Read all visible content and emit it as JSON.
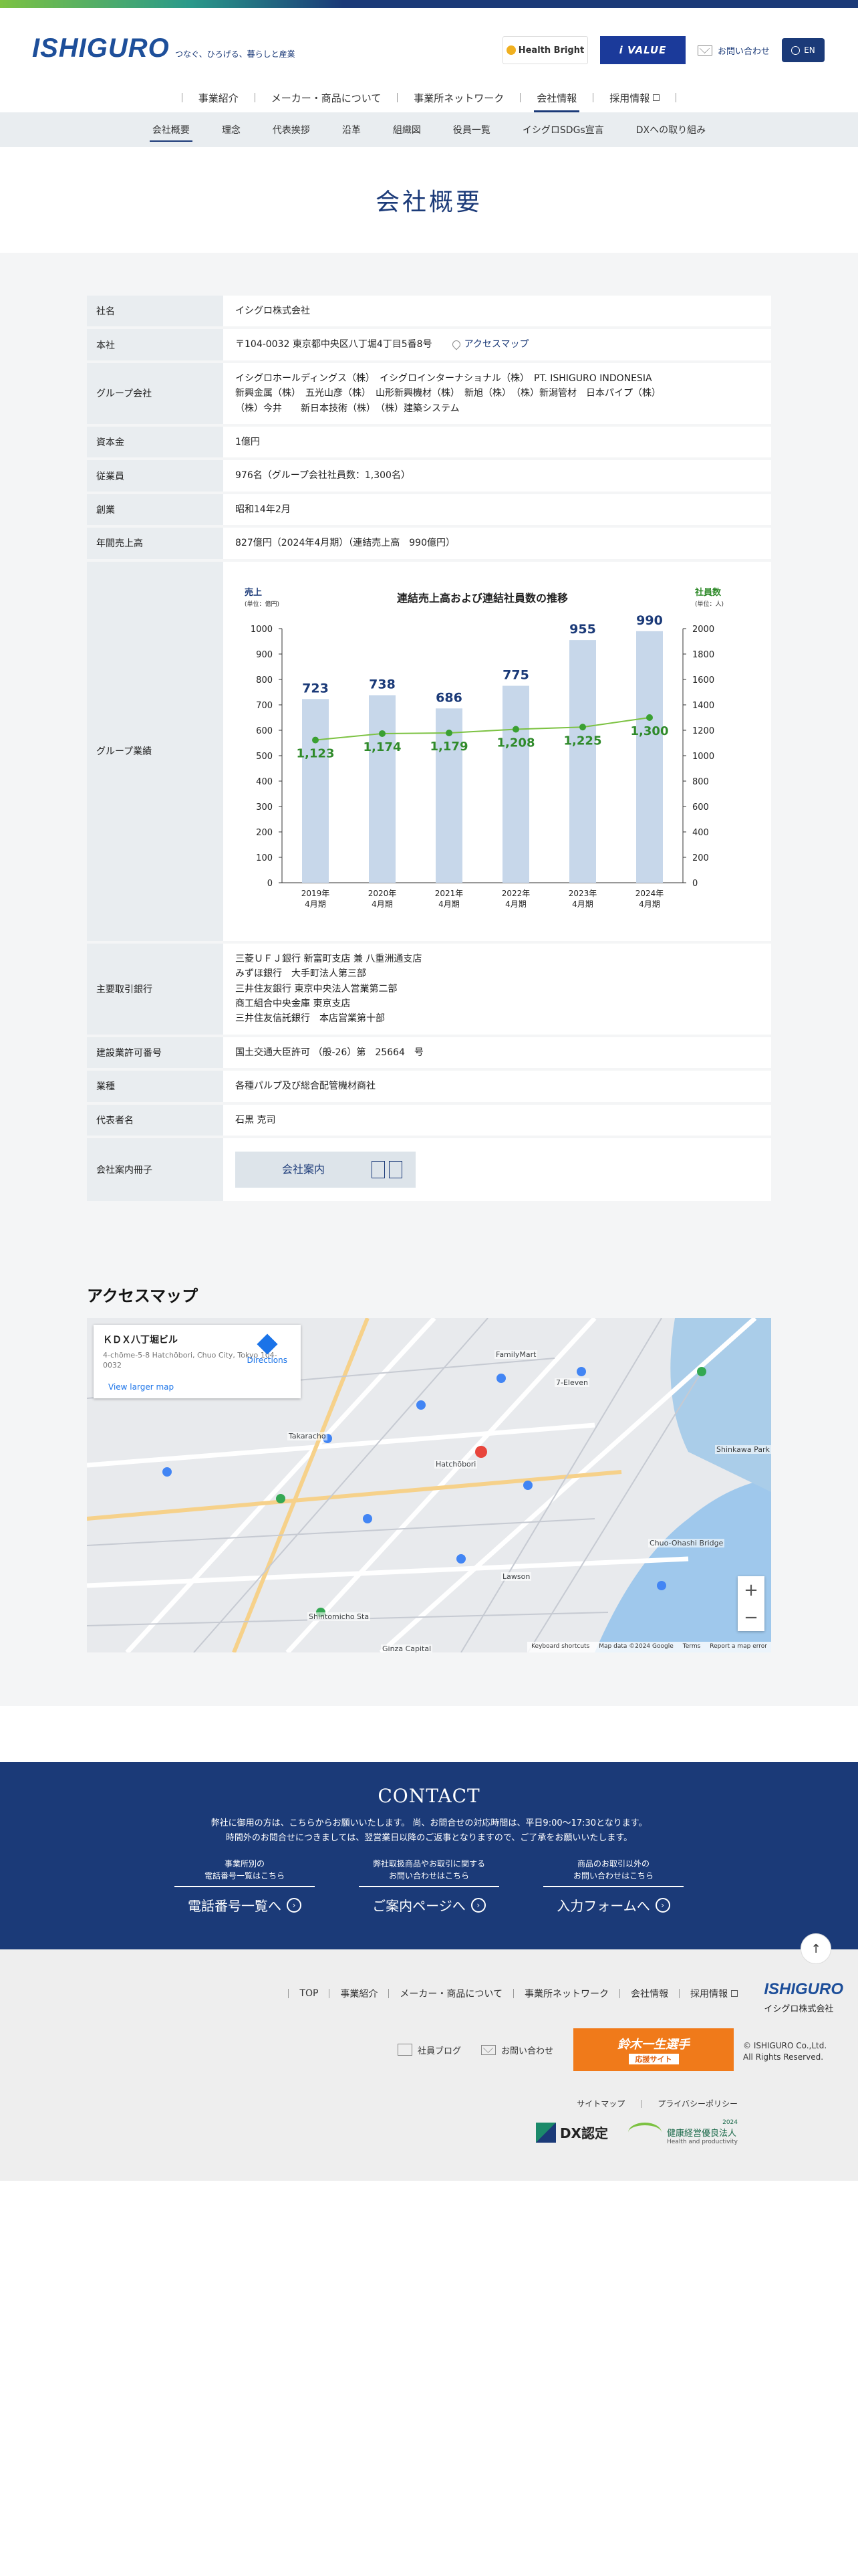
{
  "header": {
    "logo": "ISHIGURO",
    "tagline": "つなぐ、ひろげる、暮らしと産業",
    "badge_health": "Health Bright",
    "badge_ivalue": "i VALUE",
    "contact": "お問い合わせ",
    "lang": "EN"
  },
  "main_nav": [
    {
      "label": "事業紹介",
      "ext": false
    },
    {
      "label": "メーカー・商品について",
      "ext": false
    },
    {
      "label": "事業所ネットワーク",
      "ext": false
    },
    {
      "label": "会社情報",
      "ext": false
    },
    {
      "label": "採用情報",
      "ext": true
    }
  ],
  "sub_nav": [
    "会社概要",
    "理念",
    "代表挨拶",
    "沿革",
    "組織図",
    "役員一覧",
    "イシグロSDGs宣言",
    "DXへの取り組み"
  ],
  "page_title": "会社概要",
  "info": {
    "rows": [
      {
        "label": "社名",
        "value": "イシグロ株式会社"
      },
      {
        "label": "本社",
        "value": "〒104-0032 東京都中央区八丁堀4丁目5番8号",
        "link": "アクセスマップ"
      },
      {
        "label": "グループ会社",
        "value": "イシグロホールディングス（株）　イシグロインターナショナル（株）　PT. ISHIGURO INDONESIA\n新興金属（株）　五光山彦（株）　山形新興機材（株）　新旭（株）　（株）新潟管材　日本パイプ（株）\n（株）今井　　新日本技術（株）　（株）建築システム"
      },
      {
        "label": "資本金",
        "value": "1億円"
      },
      {
        "label": "従業員",
        "value": "976名（グループ会社社員数：1,300名）"
      },
      {
        "label": "創業",
        "value": "昭和14年2月"
      },
      {
        "label": "年間売上高",
        "value": "827億円（2024年4月期）（連結売上高　990億円）"
      }
    ],
    "chart_label": "グループ業績",
    "rows2": [
      {
        "label": "主要取引銀行",
        "value": "三菱ＵＦＪ銀行 新富町支店 兼 八重洲通支店\nみずほ銀行　大手町法人第三部\n三井住友銀行 東京中央法人営業第二部\n商工組合中央金庫 東京支店\n三井住友信託銀行　本店営業第十部"
      },
      {
        "label": "建設業許可番号",
        "value": "国土交通大臣許可 （般-26）第　25664　号"
      },
      {
        "label": "業種",
        "value": "各種パルプ及び総合配管機材商社"
      },
      {
        "label": "代表者名",
        "value": "石黒 克司"
      }
    ],
    "brochure_label": "会社案内冊子",
    "brochure_button": "会社案内"
  },
  "chart_data": {
    "type": "bar",
    "title": "連結売上高および連結社員数の推移",
    "left_label": "売上",
    "left_unit": "(単位：億円)",
    "right_label": "社員数",
    "right_unit": "(単位：人)",
    "categories": [
      "2019年\n4月期",
      "2020年\n4月期",
      "2021年\n4月期",
      "2022年\n4月期",
      "2023年\n4月期",
      "2024年\n4月期"
    ],
    "series": [
      {
        "name": "売上",
        "type": "bar",
        "axis": "left",
        "values": [
          723,
          738,
          686,
          775,
          955,
          990
        ],
        "color": "#c7d7ea",
        "label_color": "#1b3a78"
      },
      {
        "name": "社員数",
        "type": "line",
        "axis": "right",
        "values": [
          1123,
          1174,
          1179,
          1208,
          1225,
          1300
        ],
        "color": "#7cc242",
        "label_color": "#2f8a2a"
      }
    ],
    "ylim_left": [
      0,
      1000
    ],
    "yticks_left": [
      0,
      100,
      200,
      300,
      400,
      500,
      600,
      700,
      800,
      900,
      1000
    ],
    "ylim_right": [
      0,
      2000
    ],
    "yticks_right": [
      0,
      200,
      400,
      600,
      800,
      1000,
      1200,
      1400,
      1600,
      1800,
      2000
    ]
  },
  "access": {
    "title": "アクセスマップ",
    "place": "ＫＤＸ八丁堀ビル",
    "address": "4-chōme-5-8 Hatchōbori, Chuo City, Tokyo 104-0032",
    "directions": "Directions",
    "larger": "View larger map",
    "map_labels": [
      "Takaracho",
      "Hatchōbori",
      "Shintomicho Sta",
      "Ginza Capital",
      "Shinkawa Park",
      "Chuo-Ohashi Bridge",
      "FamilyMart",
      "Lawson",
      "7-Eleven"
    ],
    "footer_items": [
      "Keyboard shortcuts",
      "Map data ©2024 Google",
      "Terms",
      "Report a map error"
    ]
  },
  "contact": {
    "title": "CONTACT",
    "desc1": "弊社に御用の方は、こちらからお願いいたします。 尚、お問合せの対応時間は、平日9:00〜17:30となります。",
    "desc2": "時間外のお問合せにつきましては、翌営業日以降のご返事となりますので、ご了承をお願いいたします。",
    "buttons": [
      {
        "sub1": "事業所別の",
        "sub2": "電話番号一覧はこちら",
        "label": "電話番号一覧へ"
      },
      {
        "sub1": "弊社取扱商品やお取引に関する",
        "sub2": "お問い合わせはこちら",
        "label": "ご案内ページへ"
      },
      {
        "sub1": "商品のお取引以外の",
        "sub2": "お問い合わせはこちら",
        "label": "入力フォームへ"
      }
    ]
  },
  "footer": {
    "nav": [
      "TOP",
      "事業紹介",
      "メーカー・商品について",
      "事業所ネットワーク",
      "会社情報",
      "採用情報"
    ],
    "blog": "社員ブログ",
    "contact": "お問い合わせ",
    "banner_main": "鈴木一生選手",
    "banner_sub": "応援サイト",
    "logo": "ISHIGURO",
    "company": "イシグロ株式会社",
    "copyright1": "© ISHIGURO Co.,Ltd.",
    "copyright2": "All Rights Reserved.",
    "sitemap": "サイトマップ",
    "privacy": "プライバシーポリシー",
    "dx": "DX認定",
    "kenko": "健康経営優良法人",
    "kenko_year": "2024",
    "kenko_sub": "Health and productivity"
  }
}
